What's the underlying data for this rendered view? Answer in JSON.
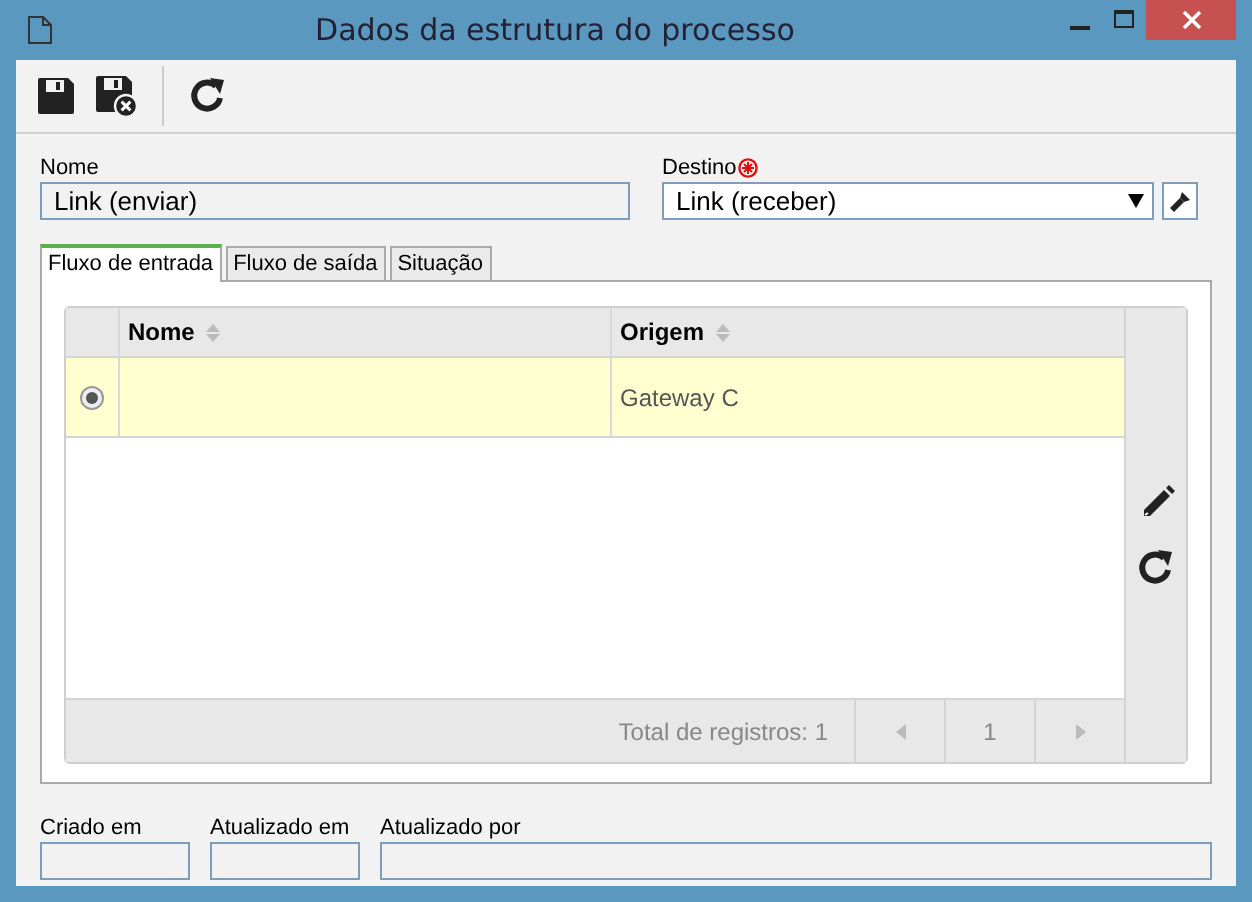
{
  "window": {
    "title": "Dados da estrutura do processo"
  },
  "toolbar": [
    {
      "kind": "save"
    },
    {
      "kind": "save-close"
    },
    {
      "kind": "separator"
    },
    {
      "kind": "refresh"
    }
  ],
  "nome": {
    "label": "Nome",
    "value": "Link (enviar)"
  },
  "destino": {
    "label": "Destino",
    "required": true,
    "value": "Link (receber)"
  },
  "tabs": [
    {
      "label": "Fluxo de entrada",
      "selected": true
    },
    {
      "label": "Fluxo de saída",
      "selected": false
    },
    {
      "label": "Situação",
      "selected": false
    }
  ],
  "grid": {
    "columns": [
      "Nome",
      "Origem"
    ],
    "rows": [
      {
        "selected": true,
        "origem": "Gateway C"
      }
    ],
    "side_tools": [
      {
        "kind": "edit"
      },
      {
        "kind": "refresh"
      }
    ],
    "total": "Total de registros: 1",
    "page": "1"
  },
  "footer_fields": [
    {
      "label": "Criado em",
      "kind": "short"
    },
    {
      "label": "Atualizado em",
      "kind": "short"
    },
    {
      "label": "Atualizado por",
      "kind": "wide"
    }
  ]
}
